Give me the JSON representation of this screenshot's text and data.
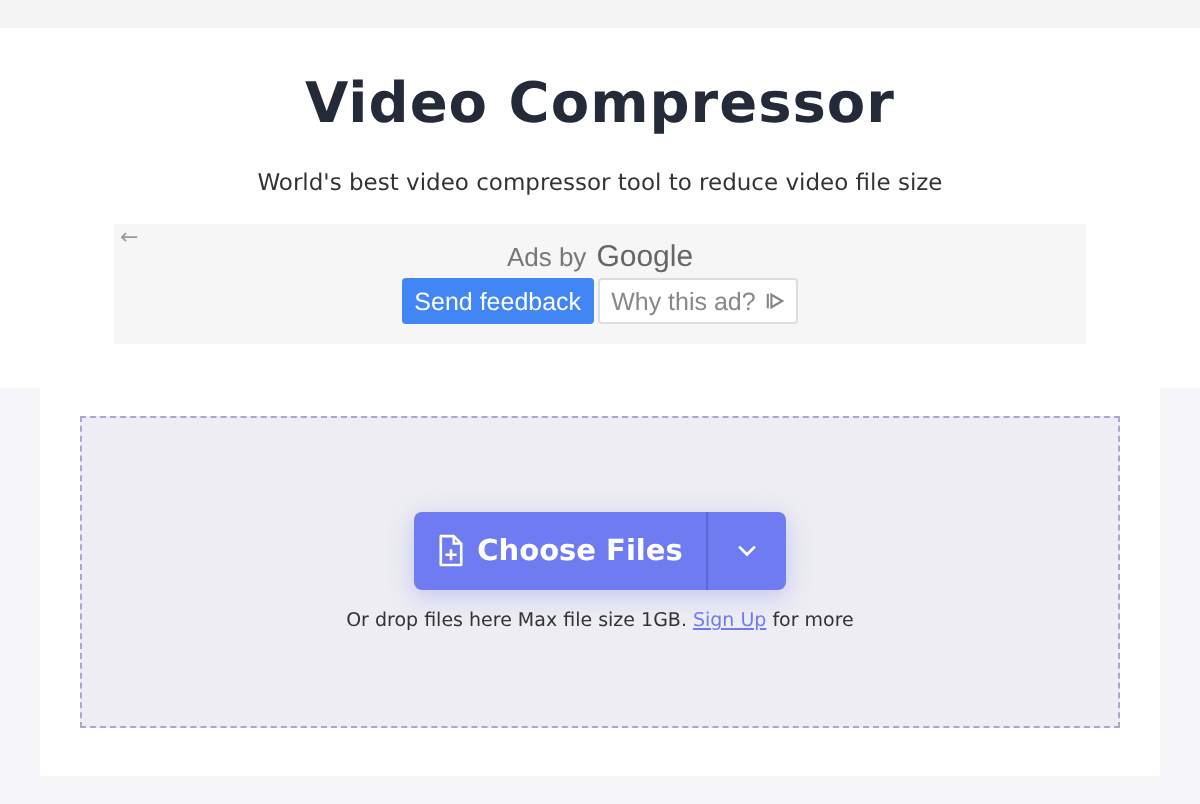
{
  "title": "Video Compressor",
  "subtitle": "World's best video compressor tool to reduce video file size",
  "ad": {
    "back": "←",
    "label_prefix": "Ads by",
    "label_brand": "Google",
    "buttons": [
      {
        "label": "Send feedback",
        "kind": "primary"
      },
      {
        "label": "Why this ad?",
        "kind": "secondary"
      }
    ]
  },
  "upload": {
    "button": "Choose Files",
    "note_before": "Or drop files here Max file size 1GB.",
    "link": "Sign Up",
    "note_after": "for more"
  }
}
